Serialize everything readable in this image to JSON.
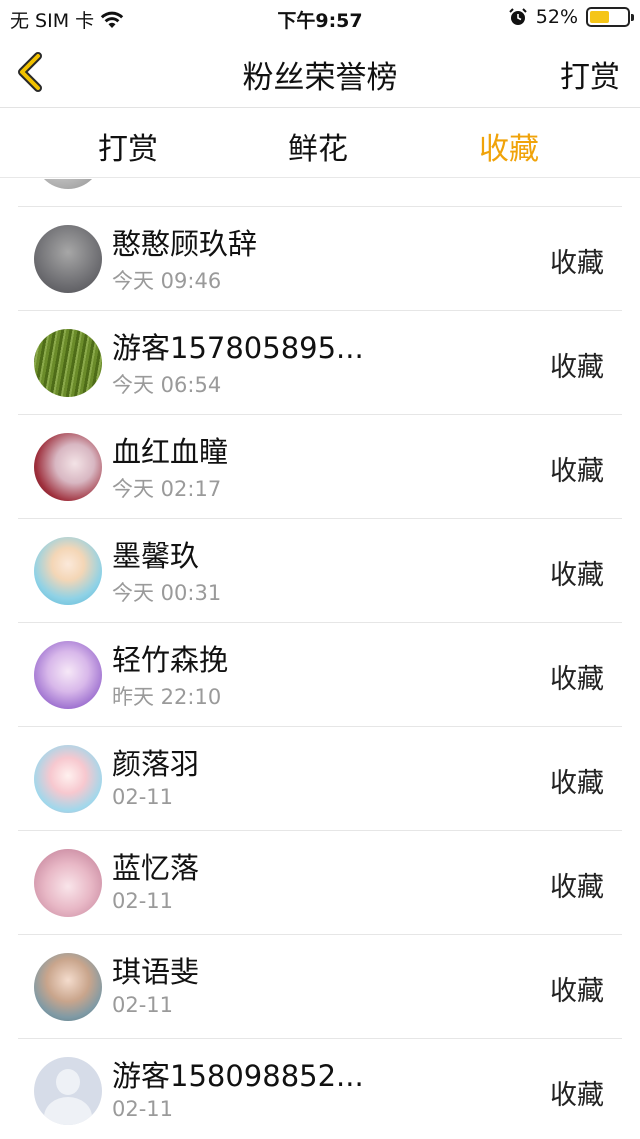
{
  "status_bar": {
    "carrier": "无 SIM 卡",
    "time": "下午9:57",
    "battery_percent": "52%",
    "battery_level": 0.52,
    "battery_color": "#f5c518"
  },
  "nav": {
    "back_icon": "chevron-left-icon",
    "title": "粉丝荣誉榜",
    "right_label": "打赏",
    "accent_color": "#f0a30a"
  },
  "tabs": [
    {
      "label": "打赏",
      "active": false
    },
    {
      "label": "鲜花",
      "active": false
    },
    {
      "label": "收藏",
      "active": true
    }
  ],
  "list": {
    "items": [
      {
        "name": "",
        "time": "",
        "action": ""
      },
      {
        "name": "憨憨顾玖辞",
        "time": "今天 09:46",
        "action": "收藏"
      },
      {
        "name": "游客157805895...",
        "time": "今天 06:54",
        "action": "收藏"
      },
      {
        "name": "血红血瞳",
        "time": "今天 02:17",
        "action": "收藏"
      },
      {
        "name": "墨馨玖",
        "time": "今天 00:31",
        "action": "收藏"
      },
      {
        "name": "轻竹森挽",
        "time": "昨天 22:10",
        "action": "收藏"
      },
      {
        "name": "颜落羽",
        "time": "02-11",
        "action": "收藏"
      },
      {
        "name": "蓝忆落",
        "time": "02-11",
        "action": "收藏"
      },
      {
        "name": "琪语斐",
        "time": "02-11",
        "action": "收藏"
      },
      {
        "name": "游客158098852...",
        "time": "02-11",
        "action": "收藏"
      }
    ]
  }
}
